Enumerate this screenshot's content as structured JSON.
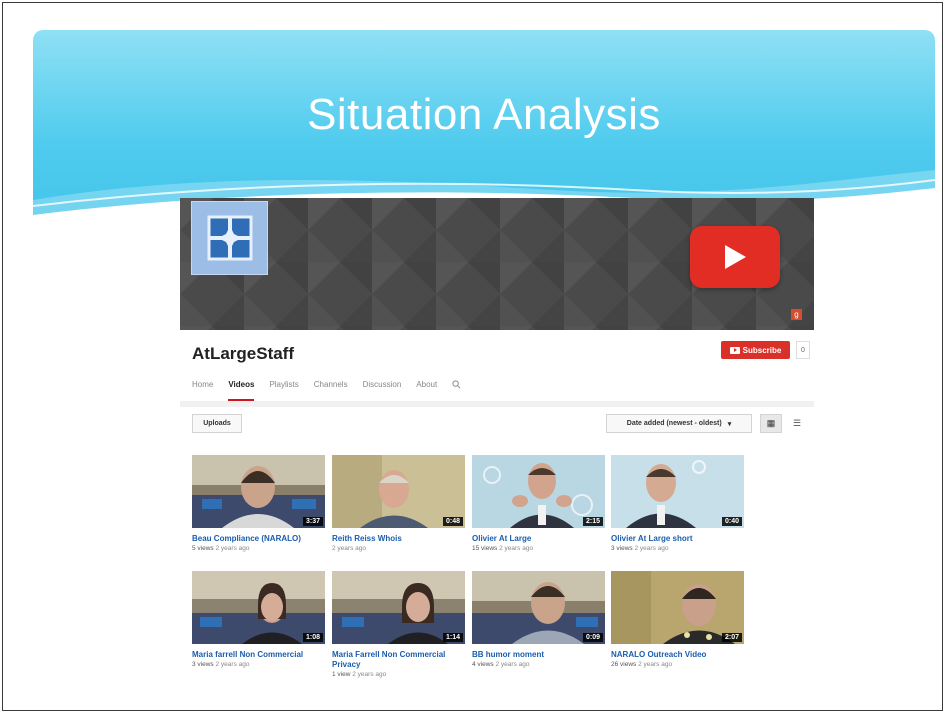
{
  "slide": {
    "title": "Situation Analysis"
  },
  "channel": {
    "name": "AtLargeStaff",
    "subscribe_label": "Subscribe",
    "subscriber_count": "0"
  },
  "tabs": [
    {
      "label": "Home",
      "active": false
    },
    {
      "label": "Videos",
      "active": true
    },
    {
      "label": "Playlists",
      "active": false
    },
    {
      "label": "Channels",
      "active": false
    },
    {
      "label": "Discussion",
      "active": false
    },
    {
      "label": "About",
      "active": false
    }
  ],
  "toolbar": {
    "uploads_label": "Uploads",
    "sort_label": "Date added (newest - oldest)"
  },
  "videos": [
    {
      "title": "Beau Compliance (NARALO)",
      "views": "5 views",
      "age": "2 years ago",
      "duration": "3:37"
    },
    {
      "title": "Reith Reiss Whois",
      "views": "",
      "age": "2 years ago",
      "duration": "0:48"
    },
    {
      "title": "Olivier At Large",
      "views": "15 views",
      "age": "2 years ago",
      "duration": "2:15"
    },
    {
      "title": "Olivier At Large short",
      "views": "3 views",
      "age": "2 years ago",
      "duration": "0:40"
    },
    {
      "title": "Maria farrell Non Commercial",
      "views": "3 views",
      "age": "2 years ago",
      "duration": "1:08"
    },
    {
      "title": "Maria Farrell Non Commercial Privacy",
      "views": "1 view",
      "age": "2 years ago",
      "duration": "1:14"
    },
    {
      "title": "BB humor moment",
      "views": "4 views",
      "age": "2 years ago",
      "duration": "0:09"
    },
    {
      "title": "NARALO Outreach Video",
      "views": "26 views",
      "age": "2 years ago",
      "duration": "2:07"
    }
  ],
  "colors": {
    "banner": "#4fcbee",
    "youtube_red": "#e22d24",
    "link_blue": "#1b5dac"
  }
}
